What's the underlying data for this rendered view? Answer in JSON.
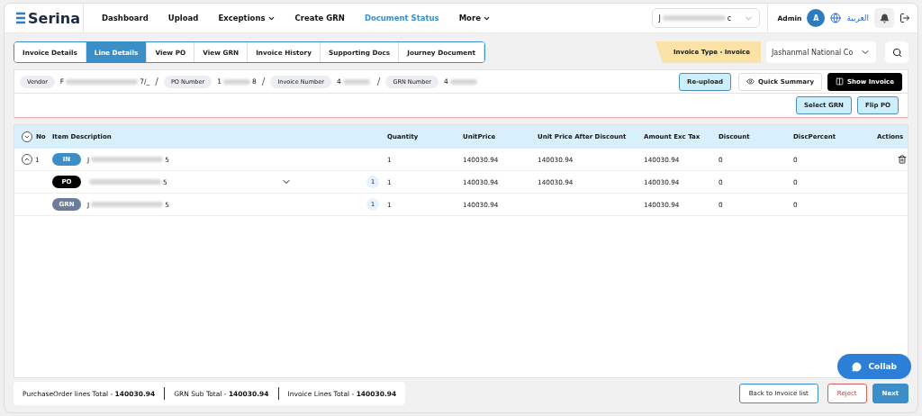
{
  "brand": "Serina",
  "nav": [
    {
      "label": "Dashboard",
      "selected": false,
      "dropdown": false
    },
    {
      "label": "Upload",
      "selected": false,
      "dropdown": false
    },
    {
      "label": "Exceptions",
      "selected": false,
      "dropdown": true
    },
    {
      "label": "Create GRN",
      "selected": false,
      "dropdown": false
    },
    {
      "label": "Document Status",
      "selected": true,
      "dropdown": false
    },
    {
      "label": "More",
      "selected": false,
      "dropdown": true
    }
  ],
  "entity_select": {
    "start": "J",
    "end": "c"
  },
  "user": {
    "name": "Admin",
    "initial": "A"
  },
  "language": "العربية",
  "tabs": [
    {
      "label": "Invoice Details",
      "selected": false
    },
    {
      "label": "Line Details",
      "selected": true
    },
    {
      "label": "View PO",
      "selected": false
    },
    {
      "label": "View GRN",
      "selected": false
    },
    {
      "label": "Invoice History",
      "selected": false
    },
    {
      "label": "Supporting Docs",
      "selected": false
    },
    {
      "label": "Journey Document",
      "selected": false
    }
  ],
  "invoice_type": "Invoice Type - Invoice",
  "company_select": "Jashanmal National Co",
  "info": [
    {
      "label": "Vendor",
      "start": "F",
      "end": "7/_"
    },
    {
      "separator": "/",
      "label": "PO Number",
      "start": "1",
      "end": "8"
    },
    {
      "separator": "/",
      "label": "Invoice Number",
      "start": "4"
    },
    {
      "separator": "/",
      "label": "GRN Number",
      "start": "4"
    }
  ],
  "info_buttons": [
    {
      "label": "Re-upload",
      "kind": "light"
    },
    {
      "label": "Quick Summary",
      "kind": "eye"
    },
    {
      "label": "Show Invoice",
      "kind": "dark"
    }
  ],
  "action_buttons": [
    "Select GRN",
    "Flip PO"
  ],
  "table": {
    "expanded": true,
    "columns": [
      "No",
      "Item Description",
      "Quantity",
      "UnitPrice",
      "Unit Price After Discount",
      "Amount Exc Tax",
      "Discount",
      "DiscPercent",
      "Actions"
    ],
    "rows": [
      {
        "kind": "IN",
        "no": "1",
        "expanded": true,
        "desc_start": "J",
        "desc_end": "5",
        "quantity": "1",
        "unit_price": "140030.94",
        "after_discount": "140030.94",
        "amount": "140030.94",
        "discount": "0",
        "disc_percent": "0",
        "deletable": true
      },
      {
        "kind": "PO",
        "desc_end": "5",
        "count": "1",
        "dropdown": true,
        "quantity": "1",
        "unit_price": "140030.94",
        "after_discount": "140030.94",
        "amount": "140030.94",
        "discount": "0",
        "disc_percent": "0"
      },
      {
        "kind": "GRN",
        "desc_start": "J",
        "desc_end": "5",
        "count": "1",
        "quantity": "1",
        "unit_price": "140030.94",
        "amount": "140030.94",
        "discount": "0",
        "disc_percent": "0"
      }
    ]
  },
  "totals": [
    {
      "label": "PurchaseOrder lines Total -",
      "value": "140030.94"
    },
    {
      "label": "GRN Sub Total -",
      "value": "140030.94"
    },
    {
      "label": "Invoice Lines Total -",
      "value": "140030.94"
    }
  ],
  "collab": "Collab",
  "footer_buttons": [
    {
      "label": "Back to Invoice list",
      "kind": "outline"
    },
    {
      "label": "Reject",
      "kind": "danger"
    },
    {
      "label": "Next",
      "kind": "primary"
    }
  ]
}
